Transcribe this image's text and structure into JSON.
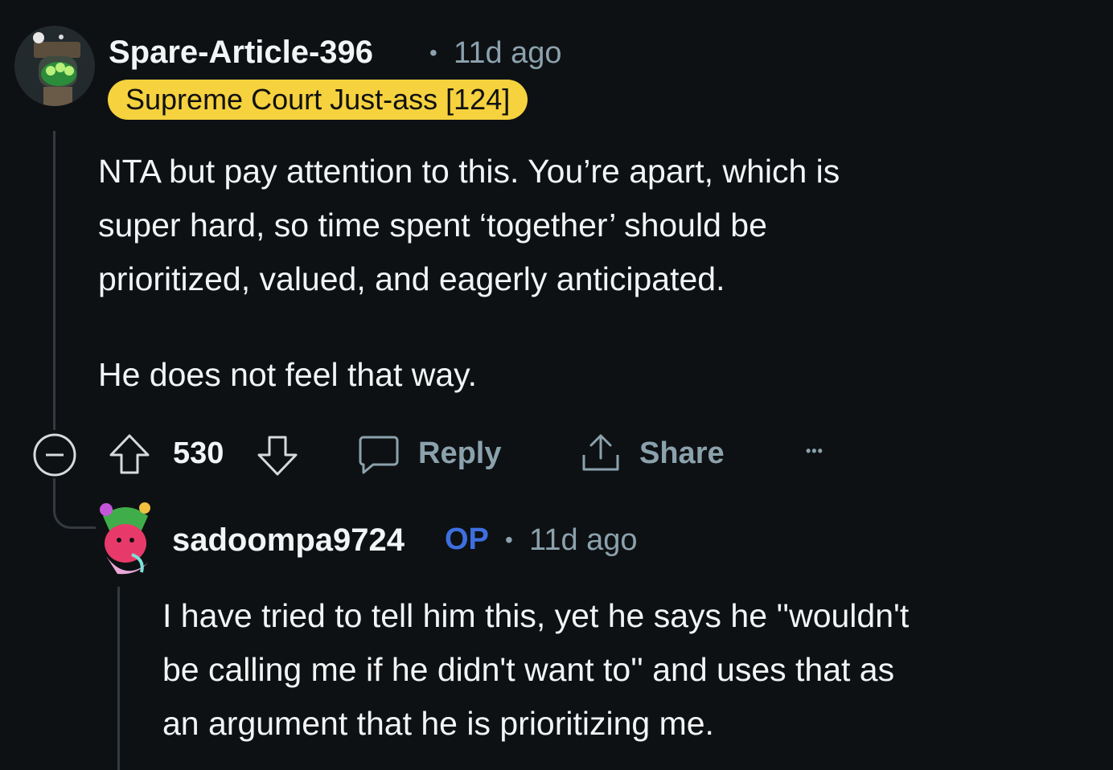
{
  "comment": {
    "author": "Spare-Article-396",
    "separator": "•",
    "time": "11d ago",
    "flair": "Supreme Court Just-ass [124]",
    "paragraphs": [
      "NTA but pay attention to this. You’re apart, which is",
      "super hard, so time spent ‘together’ should be",
      "prioritized, valued, and eagerly anticipated.",
      "He does not feel that way."
    ],
    "score": "530",
    "reply_label": "Reply",
    "share_label": "Share",
    "more_label": "•••"
  },
  "reply": {
    "author": "sadoompa9724",
    "op_badge": "OP",
    "separator": "•",
    "time": "11d ago",
    "lines": [
      "I have tried to tell him this, yet he says he ''wouldn't",
      "be calling me if he didn't want to'' and uses that as",
      "an argument that he is prioritizing me."
    ]
  },
  "colors": {
    "background": "#0e1113",
    "flair_bg": "#f5d23e",
    "op_blue": "#3d6fe0",
    "muted": "#8ba2ad"
  },
  "icons": [
    "robot-avatar",
    "collapse-icon",
    "upvote-icon",
    "downvote-icon",
    "comment-icon",
    "share-icon",
    "more-icon",
    "slime-avatar"
  ]
}
